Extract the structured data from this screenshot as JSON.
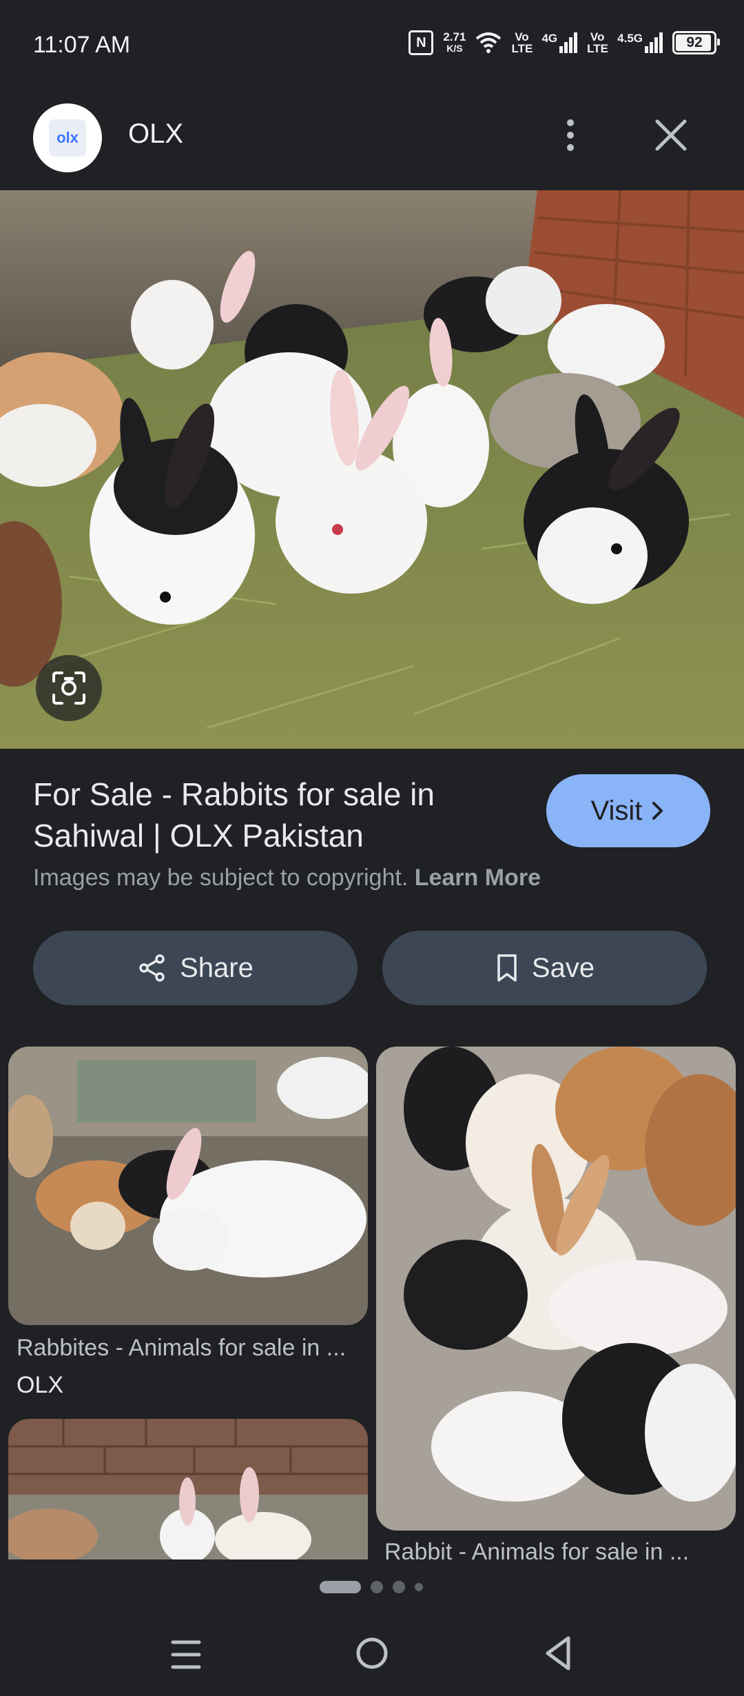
{
  "status_bar": {
    "time": "11:07 AM",
    "nfc": "N",
    "network_speed_value": "2.71",
    "network_speed_unit": "K/S",
    "volte_1": "Vo LTE",
    "signal_1_label": "4G",
    "volte_2": "Vo LTE",
    "signal_2_label": "4.5G",
    "battery_level": "92"
  },
  "header": {
    "app_logo_text": "olx",
    "title": "OLX",
    "more_icon": "more-vert-icon",
    "close_icon": "close-icon"
  },
  "hero": {
    "lens_icon": "google-lens-icon"
  },
  "result": {
    "title": "For Sale - Rabbits for sale in Sahiwal | OLX Pakistan",
    "visit_label": "Visit",
    "copyright_text": "Images may be subject to copyright.",
    "learn_more": "Learn More",
    "share_label": "Share",
    "save_label": "Save"
  },
  "related": [
    {
      "caption": "Rabbites - Animals for sale in ...",
      "source": "OLX"
    },
    {
      "caption": "Rabbit - Animals for sale in ...",
      "source": ""
    }
  ],
  "pager": {
    "active_index": 0,
    "count": 4
  },
  "nav": {
    "menu_icon": "recent-apps-icon",
    "home_icon": "home-icon",
    "back_icon": "back-icon"
  },
  "colors": {
    "background": "#202124",
    "accent": "#8ab4f8",
    "pill": "#3c4654"
  }
}
